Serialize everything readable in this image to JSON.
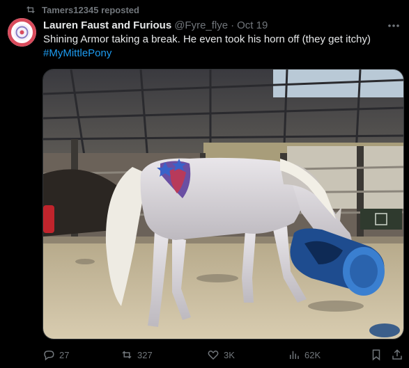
{
  "repost": {
    "user": "Tamers12345",
    "label": "reposted",
    "icon": "repost-icon"
  },
  "post": {
    "author_name": "Lauren Faust and Furious",
    "handle": "@Fyre_flye",
    "separator": "·",
    "date": "Oct 19",
    "text": "Shining Armor taking a break. He even took his horn off (they get itchy)",
    "hashtag": "#MyMittlePony"
  },
  "media": {
    "description_icon": "horse-photo"
  },
  "actions": {
    "replies": "27",
    "reposts": "327",
    "likes": "3K",
    "views": "62K"
  },
  "colors": {
    "background": "#000000",
    "text": "#e7e9ea",
    "muted": "#71767b",
    "link": "#1d9bf0"
  }
}
